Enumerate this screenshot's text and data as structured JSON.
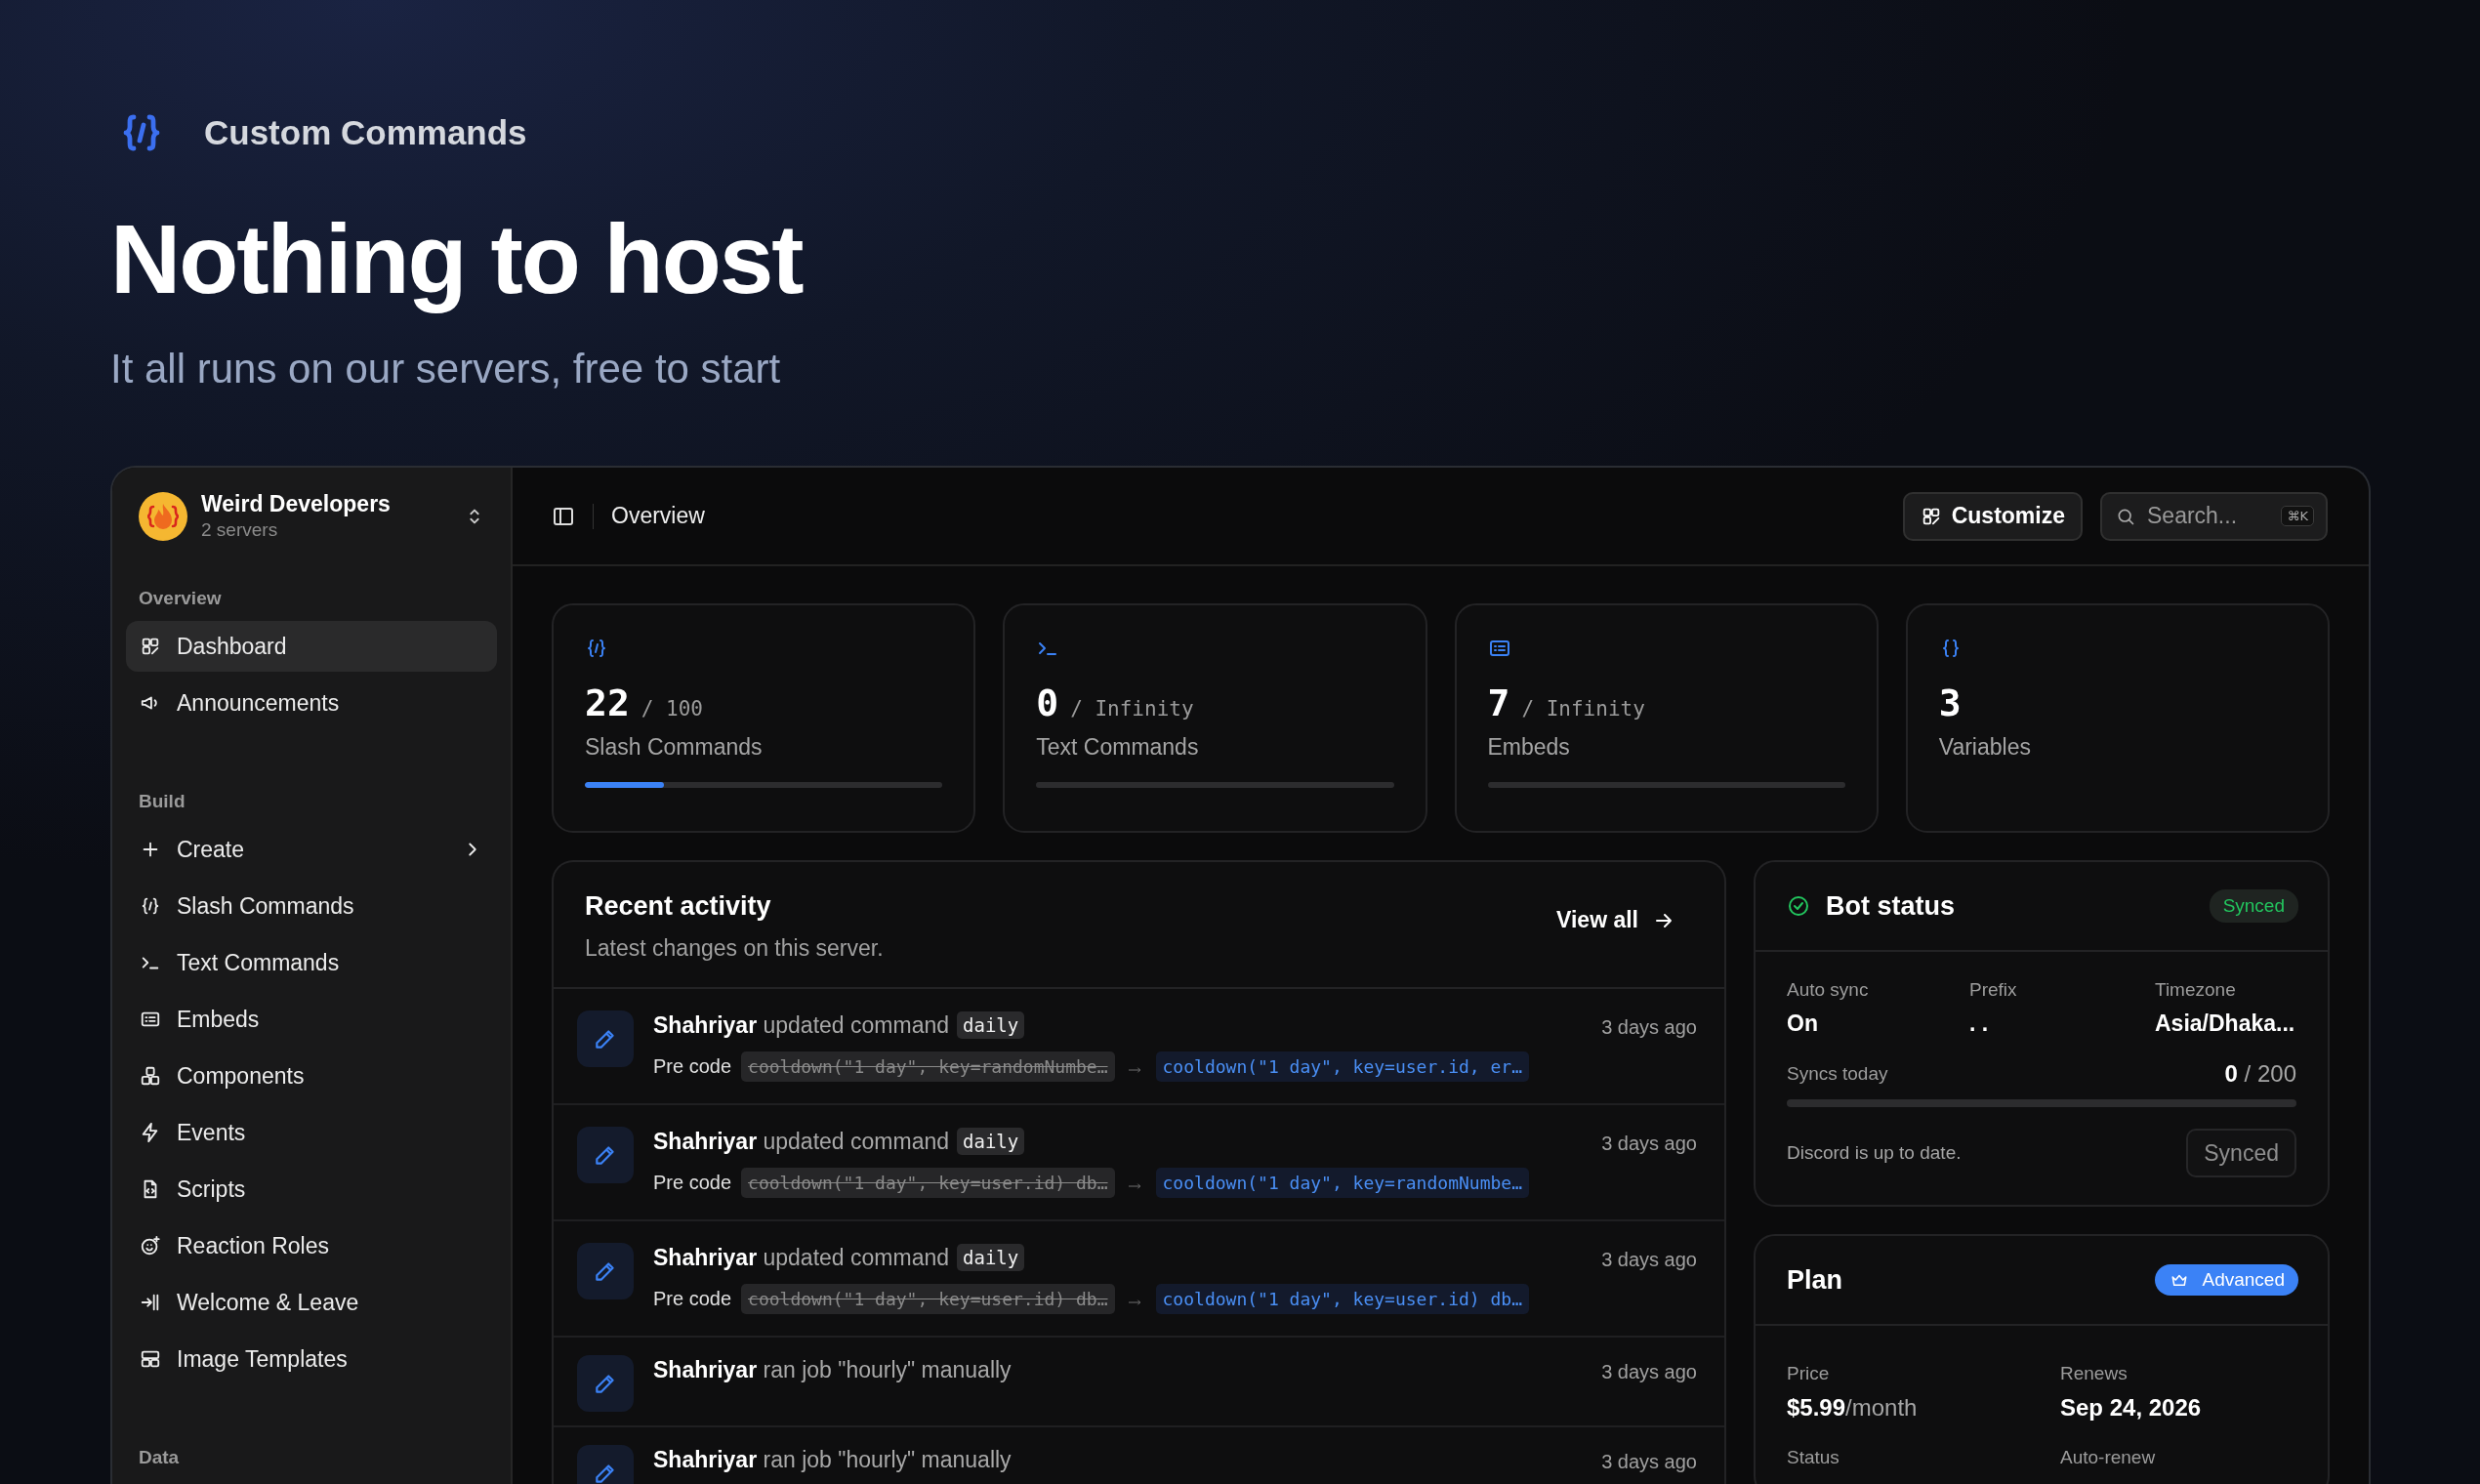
{
  "brand": {
    "name": "Custom Commands"
  },
  "hero": {
    "title": "Nothing to host",
    "subtitle": "It all runs on our servers, free to start"
  },
  "workspace": {
    "name": "Weird Developers",
    "detail": "2 servers"
  },
  "sidebar": {
    "sections": [
      {
        "title": "Overview",
        "items": [
          {
            "label": "Dashboard",
            "kind": "link",
            "selected": true
          },
          {
            "label": "Announcements",
            "kind": "link",
            "selected": false
          }
        ]
      },
      {
        "title": "Build",
        "items": [
          {
            "label": "Create",
            "kind": "menu",
            "selected": false
          },
          {
            "label": "Slash Commands",
            "kind": "link",
            "selected": false
          },
          {
            "label": "Text Commands",
            "kind": "link",
            "selected": false
          },
          {
            "label": "Embeds",
            "kind": "link",
            "selected": false
          },
          {
            "label": "Components",
            "kind": "link",
            "selected": false
          },
          {
            "label": "Events",
            "kind": "link",
            "selected": false
          },
          {
            "label": "Scripts",
            "kind": "link",
            "selected": false
          },
          {
            "label": "Reaction Roles",
            "kind": "link",
            "selected": false
          },
          {
            "label": "Welcome & Leave",
            "kind": "link",
            "selected": false
          },
          {
            "label": "Image Templates",
            "kind": "link",
            "selected": false
          }
        ]
      },
      {
        "title": "Data"
      }
    ]
  },
  "topbar": {
    "breadcrumb": "Overview",
    "customize": "Customize",
    "search": {
      "placeholder": "Search...",
      "shortcut": "⌘K"
    }
  },
  "stats": [
    {
      "value": "22",
      "limit": "/ 100",
      "label": "Slash Commands",
      "level": 0.22
    },
    {
      "value": "0",
      "limit": "/ Infinity",
      "label": "Text Commands",
      "level": 0
    },
    {
      "value": "7",
      "limit": "/ Infinity",
      "label": "Embeds",
      "level": 0
    },
    {
      "value": "3",
      "label": "Variables"
    }
  ],
  "activity": {
    "title": "Recent activity",
    "subtitle": "Latest changes on this server.",
    "view_all": "View all",
    "items": [
      {
        "kind": "update",
        "user": "Shahriyar",
        "action": "updated command",
        "command": "daily",
        "field": "Pre code",
        "old": "cooldown(\"1 day\", key=randomNumbe…",
        "new": "cooldown(\"1 day\", key=user.id, er…",
        "time": "3 days ago"
      },
      {
        "kind": "update",
        "user": "Shahriyar",
        "action": "updated command",
        "command": "daily",
        "field": "Pre code",
        "old": "cooldown(\"1 day\", key=user.id) db…",
        "new": "cooldown(\"1 day\", key=randomNumbe…",
        "time": "3 days ago"
      },
      {
        "kind": "update",
        "user": "Shahriyar",
        "action": "updated command",
        "command": "daily",
        "field": "Pre code",
        "old": "cooldown(\"1 day\", key=user.id) db…",
        "new": "cooldown(\"1 day\", key=user.id) db…",
        "time": "3 days ago"
      },
      {
        "kind": "job",
        "user": "Shahriyar",
        "action": "ran job \"hourly\" manually",
        "time": "3 days ago"
      },
      {
        "kind": "job",
        "user": "Shahriyar",
        "action": "ran job \"hourly\" manually",
        "time": "3 days ago"
      }
    ]
  },
  "bot_status": {
    "title": "Bot status",
    "badge": "Synced",
    "fields": [
      {
        "label": "Auto sync",
        "value": "On"
      },
      {
        "label": "Prefix",
        "value": ". ."
      },
      {
        "label": "Timezone",
        "value": "Asia/Dhaka..."
      }
    ],
    "syncs": {
      "label": "Syncs today",
      "used": "0",
      "quota": "/ 200",
      "level": 0
    },
    "message": "Discord is up to date.",
    "button": {
      "label": "Synced",
      "disabled": true
    }
  },
  "plan": {
    "title": "Plan",
    "badge": "Advanced",
    "fields": [
      {
        "label": "Price",
        "value": "$5.99",
        "suffix": "/month"
      },
      {
        "label": "Renews",
        "value": "Sep 24, 2026"
      },
      {
        "label": "Status"
      },
      {
        "label": "Auto-renew"
      }
    ]
  }
}
